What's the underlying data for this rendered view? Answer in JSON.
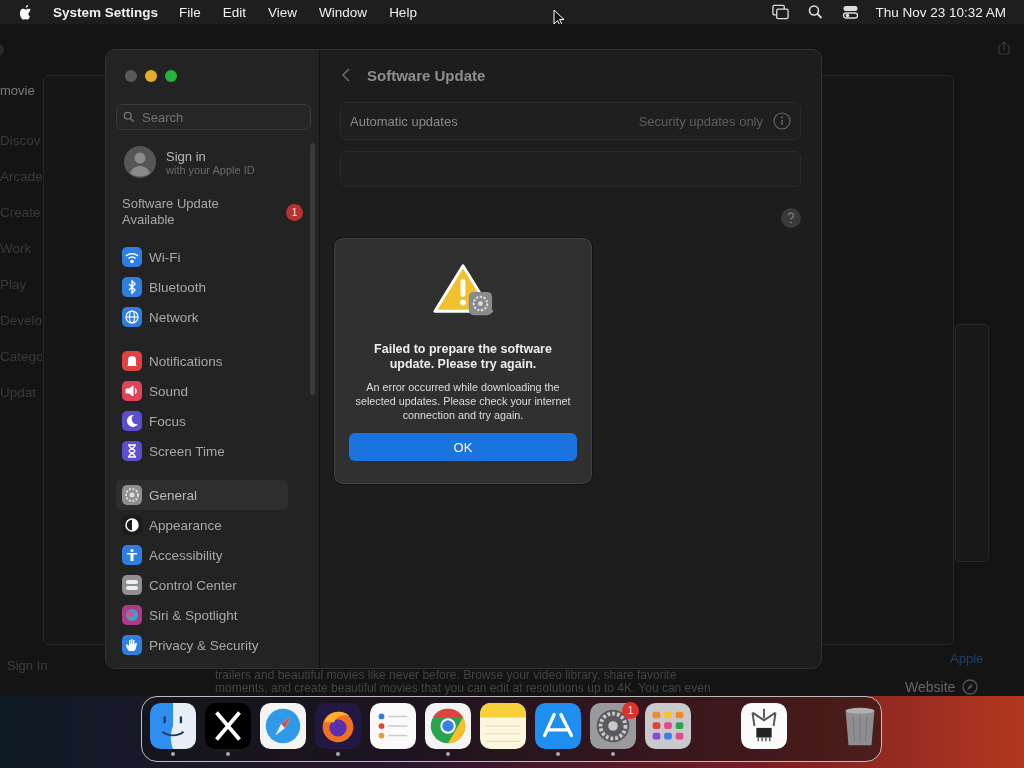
{
  "menu_bar": {
    "app_name": "System Settings",
    "menus": [
      "File",
      "Edit",
      "View",
      "Window",
      "Help"
    ],
    "clock": "Thu Nov 23  10:32 AM"
  },
  "background_app": {
    "title": "movie",
    "sidebar_items": [
      "Discov",
      "Arcade",
      "Create",
      "Work",
      "Play",
      "Develo",
      "Catego",
      "Updat"
    ],
    "sign_in": "Sign In",
    "paragraph_lines": [
      "trailers and beautiful movies like never before. Browse your video library, share favorite",
      "moments, and create beautiful movies that you can edit at resolutions up to 4K. You can even"
    ],
    "link": "Apple",
    "website_label": "Website"
  },
  "settings_window": {
    "title": "Software Update",
    "search": {
      "placeholder": "Search"
    },
    "account": {
      "title": "Sign in",
      "subtitle": "with your Apple ID"
    },
    "update_notice": {
      "label": "Software Update Available",
      "badge": "1"
    },
    "sidebar_groups": [
      [
        {
          "label": "Wi-Fi",
          "kind": "wifi",
          "color": "#2f7fe0",
          "selected": false
        },
        {
          "label": "Bluetooth",
          "kind": "bluetooth",
          "color": "#2f7fe0",
          "selected": false
        },
        {
          "label": "Network",
          "kind": "globe",
          "color": "#2f7fe0",
          "selected": false
        }
      ],
      [
        {
          "label": "Notifications",
          "kind": "bell",
          "color": "#e0433f",
          "selected": false
        },
        {
          "label": "Sound",
          "kind": "speaker",
          "color": "#e0435a",
          "selected": false
        },
        {
          "label": "Focus",
          "kind": "moon",
          "color": "#5b4fd0",
          "selected": false
        },
        {
          "label": "Screen Time",
          "kind": "hourglass",
          "color": "#5b4fd0",
          "selected": false
        }
      ],
      [
        {
          "label": "General",
          "kind": "gear",
          "color": "#8e8e93",
          "selected": true
        },
        {
          "label": "Appearance",
          "kind": "contrast",
          "color": "#1c1c1e",
          "selected": false
        },
        {
          "label": "Accessibility",
          "kind": "person",
          "color": "#2f7fe0",
          "selected": false
        },
        {
          "label": "Control Center",
          "kind": "toggles",
          "color": "#8e8e93",
          "selected": false
        },
        {
          "label": "Siri & Spotlight",
          "kind": "siri",
          "color": "#b03a8a",
          "selected": false
        },
        {
          "label": "Privacy & Security",
          "kind": "hand",
          "color": "#2f7fe0",
          "selected": false
        }
      ]
    ],
    "automatic_updates": {
      "label": "Automatic updates",
      "value": "Security updates only"
    }
  },
  "dialog": {
    "title": "Failed to prepare the software update. Please try again.",
    "message": "An error occurred while downloading the selected updates. Please check your internet connection and try again.",
    "button": "OK"
  },
  "dock": {
    "apps": [
      {
        "kind": "finder",
        "running": true
      },
      {
        "kind": "x",
        "running": true
      },
      {
        "kind": "safari",
        "running": false
      },
      {
        "kind": "firefox",
        "running": true
      },
      {
        "kind": "reminders",
        "running": false
      },
      {
        "kind": "chrome",
        "running": true
      },
      {
        "kind": "notes",
        "running": false
      },
      {
        "kind": "appstore",
        "running": true
      },
      {
        "kind": "settings",
        "running": true,
        "badge": "1"
      },
      {
        "kind": "launchpad",
        "running": false
      },
      {
        "kind": "divider"
      },
      {
        "kind": "calipers",
        "running": false
      },
      {
        "kind": "divider"
      },
      {
        "kind": "trash",
        "running": false
      }
    ]
  }
}
